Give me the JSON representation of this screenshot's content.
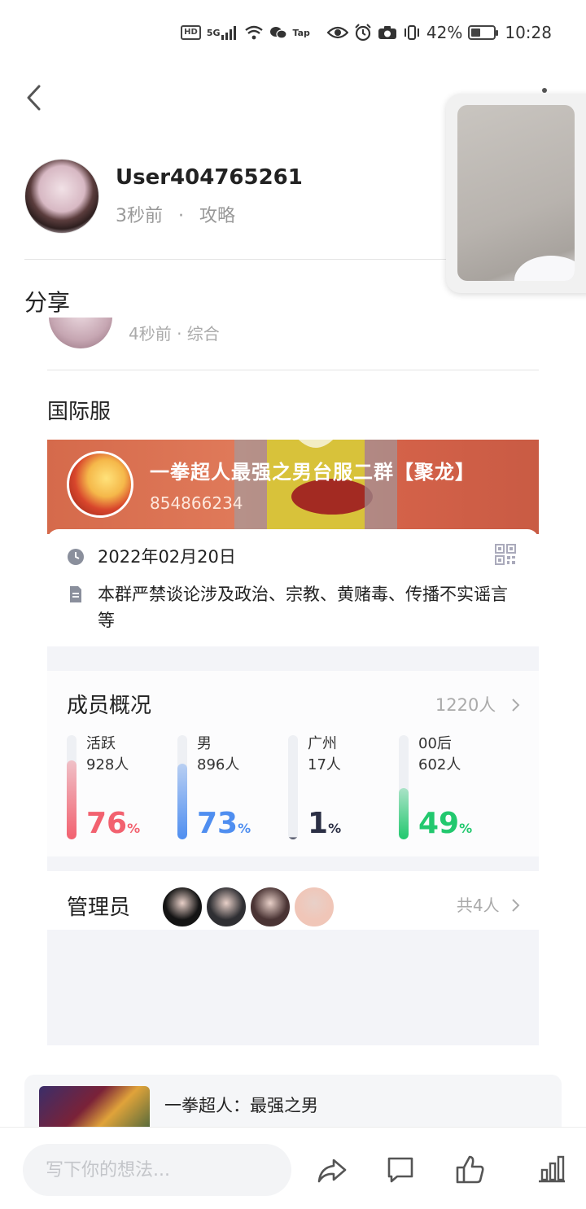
{
  "status_bar": {
    "hd": "HD",
    "signal": "5G",
    "tap": "Tap",
    "battery_text": "42%",
    "battery_level": 0.42,
    "time": "10:28"
  },
  "author": {
    "name": "User404765261",
    "time": "3秒前",
    "separator": "·",
    "category": "攻略"
  },
  "post": {
    "title": "分享"
  },
  "shared": {
    "peek_meta": "4秒前 · 综合",
    "server_label": "国际服",
    "group": {
      "name": "一拳超人最强之男台服二群【聚龙】",
      "id": "854866234",
      "date": "2022年02月20日",
      "notice": "本群严禁谈论涉及政治、宗教、黄赌毒、传播不实谣言等"
    },
    "members": {
      "title": "成员概况",
      "total": "1220人",
      "stats": [
        {
          "label": "活跃",
          "count": "928人",
          "pct": "76",
          "unit": "%",
          "color": "#f2616f",
          "level": 0.76
        },
        {
          "label": "男",
          "count": "896人",
          "pct": "73",
          "unit": "%",
          "color": "#4f8ef0",
          "level": 0.73
        },
        {
          "label": "广州",
          "count": "17人",
          "pct": "1",
          "unit": "%",
          "color": "#2b2f45",
          "level": 0.01
        },
        {
          "label": "00后",
          "count": "602人",
          "pct": "49",
          "unit": "%",
          "color": "#22c86e",
          "level": 0.49
        }
      ]
    },
    "admins": {
      "title": "管理员",
      "count": "共4人",
      "avatar_colors": [
        "#141414",
        "#2f2f33",
        "#4a3434",
        "#f0c6b8"
      ]
    }
  },
  "game": {
    "name": "一拳超人：最强之男"
  },
  "bottom": {
    "placeholder": "写下你的想法..."
  },
  "icons": [
    "back-icon",
    "share-icon",
    "comment-icon",
    "like-icon",
    "stats-icon",
    "clock-icon",
    "document-icon",
    "qr-code-icon",
    "chevron-right-icon"
  ]
}
